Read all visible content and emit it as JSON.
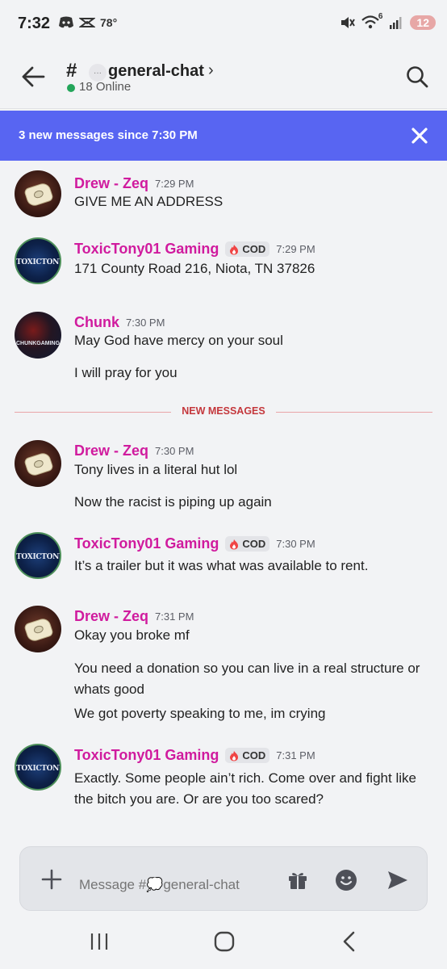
{
  "status_bar": {
    "time": "7:32",
    "temperature": "78°",
    "wifi_badge": "6",
    "battery_level": "12"
  },
  "header": {
    "channel_prefix": "#",
    "channel_name": "general-chat",
    "online_count": "18 Online"
  },
  "banner": {
    "text": "3 new messages since 7:30 PM"
  },
  "divider_label": "NEW MESSAGES",
  "messages": [
    {
      "author": "Drew - Zeq",
      "time": "7:29 PM",
      "tag": "",
      "lines": [
        "GIVE ME AN ADDRESS"
      ]
    },
    {
      "author": "ToxicTony01 Gaming",
      "time": "7:29 PM",
      "tag": "COD",
      "lines": [
        "171 County Road 216, Niota, TN 37826"
      ]
    },
    {
      "author": "Chunk",
      "time": "7:30 PM",
      "tag": "",
      "lines": [
        "May God have mercy on your soul",
        "I will pray for you"
      ]
    },
    {
      "author": "Drew - Zeq",
      "time": "7:30 PM",
      "tag": "",
      "lines": [
        "Tony lives in a literal hut lol",
        "Now the racist is piping up again"
      ]
    },
    {
      "author": "ToxicTony01 Gaming",
      "time": "7:30 PM",
      "tag": "COD",
      "lines": [
        "It’s a trailer but it was what was available to rent."
      ]
    },
    {
      "author": "Drew - Zeq",
      "time": "7:31 PM",
      "tag": "",
      "lines": [
        "Okay you broke mf",
        "You need a donation so you can live in a real structure or whats good",
        "We got poverty speaking to me, im crying"
      ]
    },
    {
      "author": "ToxicTony01 Gaming",
      "time": "7:31 PM",
      "tag": "COD",
      "lines": [
        "Exactly. Some people ain’t rich. Come over and fight like the bitch you are. Or are you too scared?"
      ]
    }
  ],
  "avatars": {
    "tony_label": "TOXICTONY01",
    "chunk_label": "CHUNKGAMING"
  },
  "composer": {
    "placeholder": "Message #💭general-chat"
  },
  "colors": {
    "accent": "#5865f2",
    "author": "#d01b9e",
    "new_divider": "#c4373c",
    "online": "#23a55a"
  }
}
